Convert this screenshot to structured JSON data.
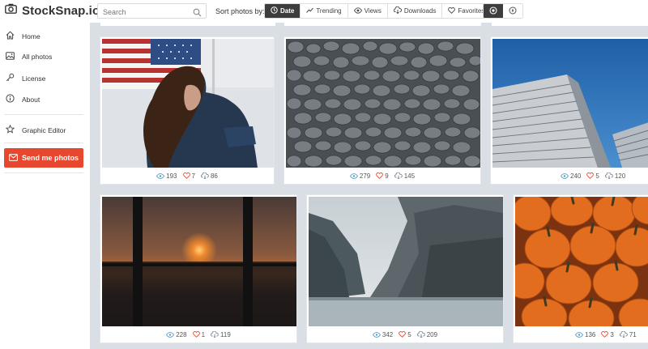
{
  "header": {
    "logo_text": "StockSnap.io",
    "search_placeholder": "Search",
    "sort_label": "Sort photos by:",
    "sort_options": [
      {
        "label": "Date",
        "icon": "clock-icon",
        "active": true
      },
      {
        "label": "Trending",
        "icon": "trending-icon",
        "active": false
      },
      {
        "label": "Views",
        "icon": "eye-icon",
        "active": false
      },
      {
        "label": "Downloads",
        "icon": "cloud-download-icon",
        "active": false
      },
      {
        "label": "Favorites",
        "icon": "heart-icon",
        "active": false
      }
    ],
    "view_options": [
      {
        "icon": "grid-view-icon",
        "active": true
      },
      {
        "icon": "compass-icon",
        "active": false
      }
    ]
  },
  "sidebar": {
    "items": [
      {
        "label": "Home",
        "icon": "home-icon"
      },
      {
        "label": "All photos",
        "icon": "image-icon"
      },
      {
        "label": "License",
        "icon": "key-icon"
      },
      {
        "label": "About",
        "icon": "info-icon"
      },
      {
        "label": "Graphic Editor",
        "icon": "star-icon"
      }
    ],
    "send_button": "Send me photos"
  },
  "photos": [
    {
      "subject": "woman with flag",
      "views": "193",
      "likes": "7",
      "downloads": "86"
    },
    {
      "subject": "pebbles",
      "views": "279",
      "likes": "9",
      "downloads": "145"
    },
    {
      "subject": "skyscraper",
      "views": "240",
      "likes": "5",
      "downloads": "120"
    },
    {
      "subject": "sunset window",
      "views": "228",
      "likes": "1",
      "downloads": "119"
    },
    {
      "subject": "mountain lake",
      "views": "342",
      "likes": "5",
      "downloads": "209"
    },
    {
      "subject": "pumpkins",
      "views": "136",
      "likes": "3",
      "downloads": "71"
    }
  ],
  "colors": {
    "accent": "#e8472f",
    "active_sort": "#3d3d3d",
    "grid_bg": "#d9dfe5",
    "view_icon": "#5a9bc4",
    "like_icon": "#e8472f",
    "download_icon": "#7a8a99"
  }
}
